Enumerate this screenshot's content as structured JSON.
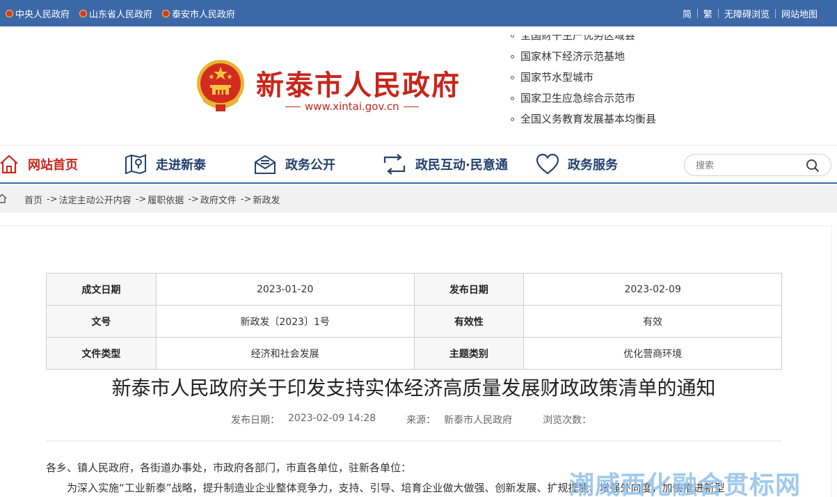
{
  "topbar": {
    "left_links": [
      {
        "label": "中央人民政府"
      },
      {
        "label": "山东省人民政府"
      },
      {
        "label": "泰安市人民政府"
      }
    ],
    "right_links": [
      {
        "label": "简"
      },
      {
        "label": "繁"
      },
      {
        "label": "无障碍浏览"
      },
      {
        "label": "网站地图"
      }
    ],
    "bg_color": "#3d68a8"
  },
  "header": {
    "site_name": "新泰市人民政府",
    "site_url": "www.xintai.gov.cn",
    "brand_color": "#c8261c",
    "honors": [
      "全国财干生产优势区域县",
      "国家林下经济示范基地",
      "国家节水型城市",
      "国家卫生应急综合示范市",
      "全国义务教育发展基本均衡县"
    ]
  },
  "nav": {
    "items": [
      {
        "label": "网站首页",
        "icon": "home-icon"
      },
      {
        "label": "走进新泰",
        "icon": "map-icon"
      },
      {
        "label": "政务公开",
        "icon": "mail-icon"
      },
      {
        "label": "政民互动·民意通",
        "icon": "exchange-icon"
      },
      {
        "label": "政务服务",
        "icon": "heart-icon"
      }
    ],
    "search_placeholder": "搜索"
  },
  "breadcrumb": {
    "items": [
      "首页",
      "法定主动公开内容",
      "履职依据",
      "政府文件",
      "新政发"
    ],
    "separator": "->"
  },
  "meta_table": {
    "rows": [
      {
        "k1": "成文日期",
        "v1": "2023-01-20",
        "k2": "发布日期",
        "v2": "2023-02-09"
      },
      {
        "k1": "文号",
        "v1": "新政发〔2023〕1号",
        "k2": "有效性",
        "v2": "有效"
      },
      {
        "k1": "文件类型",
        "v1": "经济和社会发展",
        "k2": "主题类别",
        "v2": "优化营商环境"
      }
    ]
  },
  "document": {
    "title": "新泰市人民政府关于印发支持实体经济高质量发展财政政策清单的通知",
    "publish_label": "发布日期：",
    "publish_value": "2023-02-09 14:28",
    "source_label": "来源：",
    "source_value": "新泰市人民政府",
    "views_label": "浏览次数：",
    "addressee": "各乡、镇人民政府，各街道办事处，市政府各部门，市直各单位，驻新各单位：",
    "paragraph1": "为深入实施“工业新泰”战略，提升制造业企业整体竞争力，支持、引导、培育企业做大做强、创新发展、扩规提能、增强外向度，加快推进新型"
  },
  "watermark": "潮威西化融合贯标网"
}
